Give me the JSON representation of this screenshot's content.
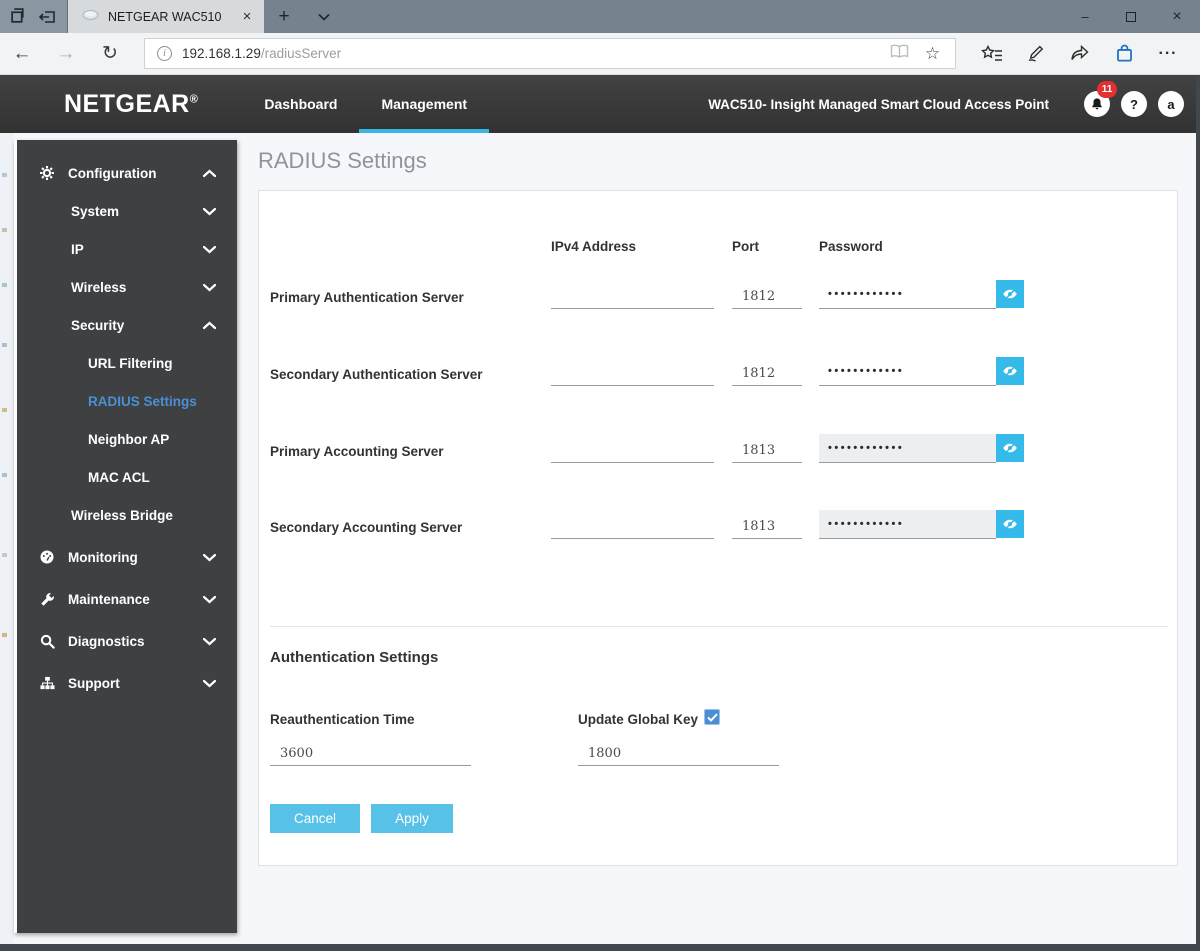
{
  "colors": {
    "accent_cyan": "#38b6e6",
    "button_cyan": "#57c1e8",
    "eye_button_cyan": "#35baea",
    "active_link_blue": "#4a90d2",
    "badge_red": "#e33030",
    "header_dark": "#3a3a3a",
    "sidebar_dark": "#3e4042"
  },
  "browser": {
    "tab_title": "NETGEAR WAC510",
    "url": {
      "host": "192.168.1.29",
      "path": "/radiusServer"
    },
    "icons": {
      "back": "←",
      "forward": "→",
      "refresh": "↻",
      "star": "☆",
      "new_tab": "+",
      "close_tab": "×",
      "ellipsis": "···",
      "info": "i",
      "minimize": "–",
      "close_window": "×"
    }
  },
  "header": {
    "brand": "NETGEAR",
    "brand_mark": "®",
    "nav": [
      {
        "label": "Dashboard",
        "active": false
      },
      {
        "label": "Management",
        "active": true
      }
    ],
    "device_label": "WAC510- Insight Managed Smart Cloud Access Point",
    "notification_count": "11",
    "help_label": "?",
    "avatar_label": "a"
  },
  "sidebar": {
    "items": [
      {
        "label": "Configuration",
        "level": 1,
        "icon": "gear",
        "chevron": "up",
        "active": false
      },
      {
        "label": "System",
        "level": 2,
        "chevron": "down",
        "active": false
      },
      {
        "label": "IP",
        "level": 2,
        "chevron": "down",
        "active": false
      },
      {
        "label": "Wireless",
        "level": 2,
        "chevron": "down",
        "active": false
      },
      {
        "label": "Security",
        "level": 2,
        "chevron": "up",
        "active": false
      },
      {
        "label": "URL Filtering",
        "level": 3,
        "chevron": "none",
        "active": false
      },
      {
        "label": "RADIUS Settings",
        "level": 3,
        "chevron": "none",
        "active": true
      },
      {
        "label": "Neighbor AP",
        "level": 3,
        "chevron": "none",
        "active": false
      },
      {
        "label": "MAC ACL",
        "level": 3,
        "chevron": "none",
        "active": false
      },
      {
        "label": "Wireless Bridge",
        "level": 2,
        "chevron": "none",
        "active": false
      },
      {
        "label": "Monitoring",
        "level": 1,
        "icon": "gauge",
        "chevron": "down",
        "active": false
      },
      {
        "label": "Maintenance",
        "level": 1,
        "icon": "wrench",
        "chevron": "down",
        "active": false
      },
      {
        "label": "Diagnostics",
        "level": 1,
        "icon": "magnifier",
        "chevron": "down",
        "active": false
      },
      {
        "label": "Support",
        "level": 1,
        "icon": "sitemap",
        "chevron": "down",
        "active": false
      }
    ]
  },
  "main": {
    "page_title": "RADIUS Settings",
    "table": {
      "columns": {
        "ipv4": "IPv4 Address",
        "port": "Port",
        "password": "Password"
      },
      "rows": [
        {
          "label": "Primary Authentication Server",
          "ipv4": "",
          "port": "1812",
          "password_masked": "••••••••••••",
          "password_disabled": false
        },
        {
          "label": "Secondary Authentication Server",
          "ipv4": "",
          "port": "1812",
          "password_masked": "••••••••••••",
          "password_disabled": false
        },
        {
          "label": "Primary Accounting Server",
          "ipv4": "",
          "port": "1813",
          "password_masked": "••••••••••••",
          "password_disabled": true
        },
        {
          "label": "Secondary Accounting Server",
          "ipv4": "",
          "port": "1813",
          "password_masked": "••••••••••••",
          "password_disabled": true
        }
      ]
    },
    "auth_settings": {
      "heading": "Authentication Settings",
      "reauth_label": "Reauthentication Time",
      "reauth_value": "3600",
      "update_key_label": "Update Global Key",
      "update_key_checked": true,
      "update_key_value": "1800"
    },
    "buttons": {
      "cancel": "Cancel",
      "apply": "Apply"
    }
  }
}
